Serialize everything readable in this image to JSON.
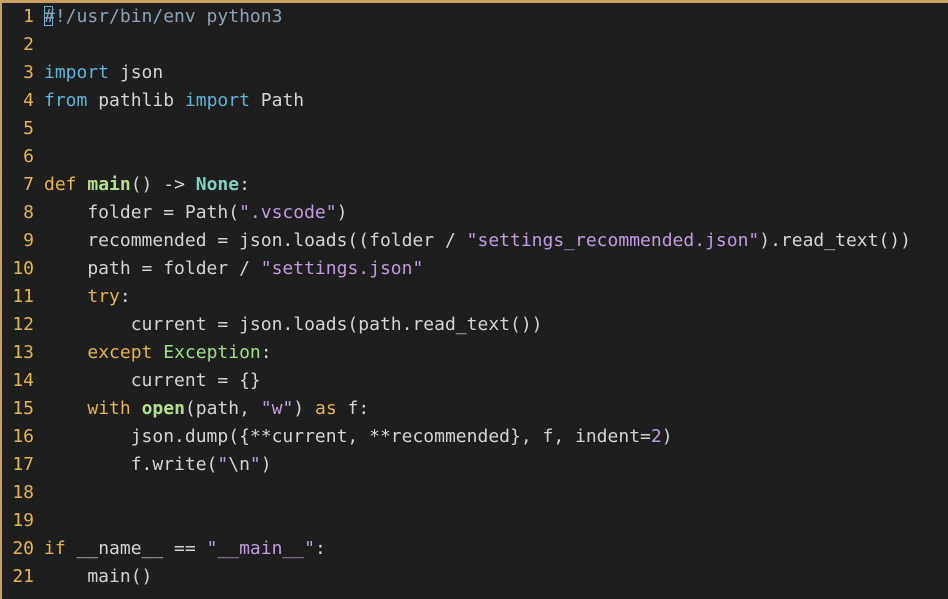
{
  "editor": {
    "language": "python",
    "colors": {
      "border": "#c8a064",
      "background": "#1e1e1e",
      "line_number": "#e6b450",
      "keyword": "#e6b450",
      "import_keyword": "#5fb3d6",
      "function": "#b5e08a",
      "string": "#c29ae0",
      "comment": "#8aa3b8"
    },
    "lines": [
      {
        "n": "1",
        "tokens": [
          {
            "t": "#!/usr/bin/env python3",
            "c": "comment"
          }
        ]
      },
      {
        "n": "2",
        "tokens": []
      },
      {
        "n": "3",
        "tokens": [
          {
            "t": "import",
            "c": "kwcyan"
          },
          {
            "t": " json",
            "c": "plain"
          }
        ]
      },
      {
        "n": "4",
        "tokens": [
          {
            "t": "from",
            "c": "kwcyan"
          },
          {
            "t": " pathlib ",
            "c": "plain"
          },
          {
            "t": "import",
            "c": "kwcyan"
          },
          {
            "t": " Path",
            "c": "plain"
          }
        ]
      },
      {
        "n": "5",
        "tokens": []
      },
      {
        "n": "6",
        "tokens": []
      },
      {
        "n": "7",
        "tokens": [
          {
            "t": "def",
            "c": "kw"
          },
          {
            "t": " ",
            "c": "plain"
          },
          {
            "t": "main",
            "c": "fn"
          },
          {
            "t": "() -> ",
            "c": "plain"
          },
          {
            "t": "None",
            "c": "const"
          },
          {
            "t": ":",
            "c": "plain"
          }
        ]
      },
      {
        "n": "8",
        "tokens": [
          {
            "t": "    folder = Path(",
            "c": "plain"
          },
          {
            "t": "\".vscode\"",
            "c": "str"
          },
          {
            "t": ")",
            "c": "plain"
          }
        ]
      },
      {
        "n": "9",
        "tokens": [
          {
            "t": "    recommended = json.loads((folder / ",
            "c": "plain"
          },
          {
            "t": "\"settings_recommended.json\"",
            "c": "str"
          },
          {
            "t": ").read_text())",
            "c": "plain"
          }
        ]
      },
      {
        "n": "10",
        "tokens": [
          {
            "t": "    path = folder / ",
            "c": "plain"
          },
          {
            "t": "\"settings.json\"",
            "c": "str"
          }
        ]
      },
      {
        "n": "11",
        "tokens": [
          {
            "t": "    ",
            "c": "plain"
          },
          {
            "t": "try",
            "c": "kw"
          },
          {
            "t": ":",
            "c": "plain"
          }
        ]
      },
      {
        "n": "12",
        "tokens": [
          {
            "t": "        current = json.loads(path.read_text())",
            "c": "plain"
          }
        ]
      },
      {
        "n": "13",
        "tokens": [
          {
            "t": "    ",
            "c": "plain"
          },
          {
            "t": "except",
            "c": "kw"
          },
          {
            "t": " ",
            "c": "plain"
          },
          {
            "t": "Exception",
            "c": "class"
          },
          {
            "t": ":",
            "c": "plain"
          }
        ]
      },
      {
        "n": "14",
        "tokens": [
          {
            "t": "        current = {}",
            "c": "plain"
          }
        ]
      },
      {
        "n": "15",
        "tokens": [
          {
            "t": "    ",
            "c": "plain"
          },
          {
            "t": "with",
            "c": "kw"
          },
          {
            "t": " ",
            "c": "plain"
          },
          {
            "t": "open",
            "c": "fn"
          },
          {
            "t": "(path, ",
            "c": "plain"
          },
          {
            "t": "\"w\"",
            "c": "str"
          },
          {
            "t": ") ",
            "c": "plain"
          },
          {
            "t": "as",
            "c": "kw"
          },
          {
            "t": " f:",
            "c": "plain"
          }
        ]
      },
      {
        "n": "16",
        "tokens": [
          {
            "t": "        json.dump({**current, **recommended}, f, indent=",
            "c": "plain"
          },
          {
            "t": "2",
            "c": "num"
          },
          {
            "t": ")",
            "c": "plain"
          }
        ]
      },
      {
        "n": "17",
        "tokens": [
          {
            "t": "        f.write(",
            "c": "plain"
          },
          {
            "t": "\"",
            "c": "str"
          },
          {
            "t": "\\n",
            "c": "plain"
          },
          {
            "t": "\"",
            "c": "str"
          },
          {
            "t": ")",
            "c": "plain"
          }
        ]
      },
      {
        "n": "18",
        "tokens": []
      },
      {
        "n": "19",
        "tokens": []
      },
      {
        "n": "20",
        "tokens": [
          {
            "t": "if",
            "c": "kw"
          },
          {
            "t": " __name__ == ",
            "c": "plain"
          },
          {
            "t": "\"__main__\"",
            "c": "str"
          },
          {
            "t": ":",
            "c": "plain"
          }
        ]
      },
      {
        "n": "21",
        "tokens": [
          {
            "t": "    main()",
            "c": "plain"
          }
        ]
      }
    ]
  }
}
